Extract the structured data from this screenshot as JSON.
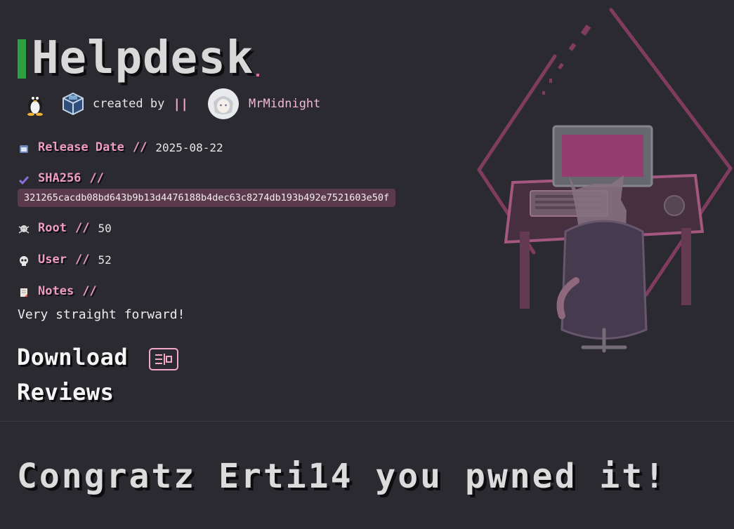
{
  "machine": {
    "name": "Helpdesk",
    "created_by_label": "created by",
    "separator": "||",
    "author": "MrMidnight",
    "platform_icons": [
      "linux-penguin-icon",
      "virtualbox-icon"
    ]
  },
  "info": {
    "release_label": "Release Date",
    "release_sep": "//",
    "release_value": "2025-08-22",
    "sha_label": "SHA256",
    "sha_sep": "//",
    "sha_value": "321265cacdb08bd643b9b13d4476188b4dec63c8274db193b492e7521603e50f",
    "root_label": "Root",
    "root_sep": "//",
    "root_value": "50",
    "user_label": "User",
    "user_sep": "//",
    "user_value": "52",
    "notes_label": "Notes",
    "notes_sep": "//",
    "notes_text": "Very straight forward!"
  },
  "sections": {
    "download": "Download",
    "reviews": "Reviews"
  },
  "congrats": "Congratz Erti14 you pwned it!",
  "colors": {
    "background": "#2b2a30",
    "accent_green": "#2ea043",
    "accent_pink": "#ee9cc2",
    "hash_bg": "#5b3a4b"
  }
}
